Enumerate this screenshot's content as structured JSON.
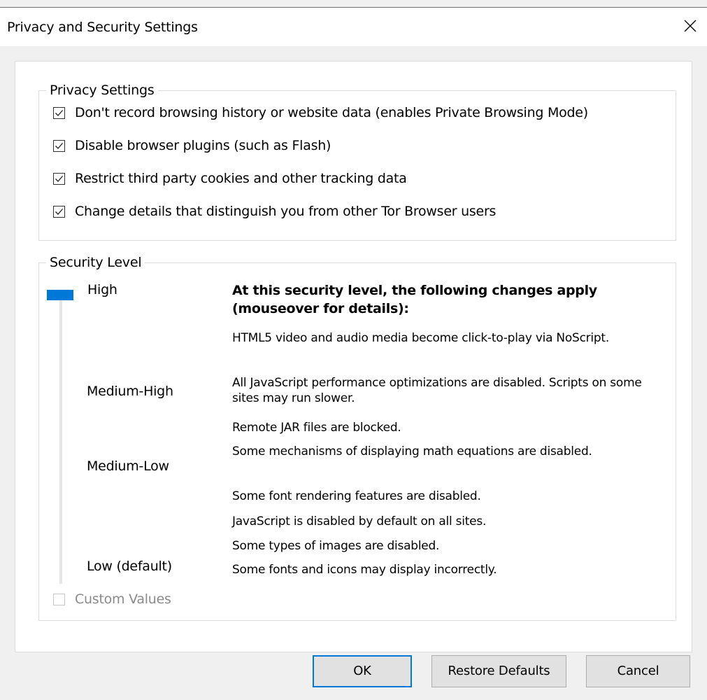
{
  "window": {
    "title": "Privacy and Security Settings"
  },
  "privacy": {
    "title": "Privacy Settings",
    "options": [
      {
        "label": "Don't record browsing history or website data (enables Private Browsing Mode)",
        "checked": true
      },
      {
        "label": "Disable browser plugins (such as Flash)",
        "checked": true
      },
      {
        "label": "Restrict third party cookies and other tracking data",
        "checked": true
      },
      {
        "label": "Change details that distinguish you from other Tor Browser users",
        "checked": true
      }
    ]
  },
  "security": {
    "title": "Security Level",
    "levels": [
      "High",
      "Medium-High",
      "Medium-Low",
      "Low (default)"
    ],
    "selected_level": "High",
    "heading": "At this security level, the following changes apply (mouseover for details):",
    "changes": [
      "HTML5 video and audio media become click-to-play via NoScript.",
      "All JavaScript performance optimizations are disabled. Scripts on some sites may run slower.",
      "Remote JAR files are blocked.",
      "Some mechanisms of displaying math equations are disabled.",
      "Some font rendering features are disabled.",
      "JavaScript is disabled by default on all sites.",
      "Some types of images are disabled.",
      "Some fonts and icons may display incorrectly."
    ],
    "custom_values": {
      "label": "Custom Values",
      "checked": false,
      "enabled": false
    }
  },
  "buttons": {
    "ok": "OK",
    "restore": "Restore Defaults",
    "cancel": "Cancel"
  },
  "colors": {
    "accent": "#0078d7"
  }
}
